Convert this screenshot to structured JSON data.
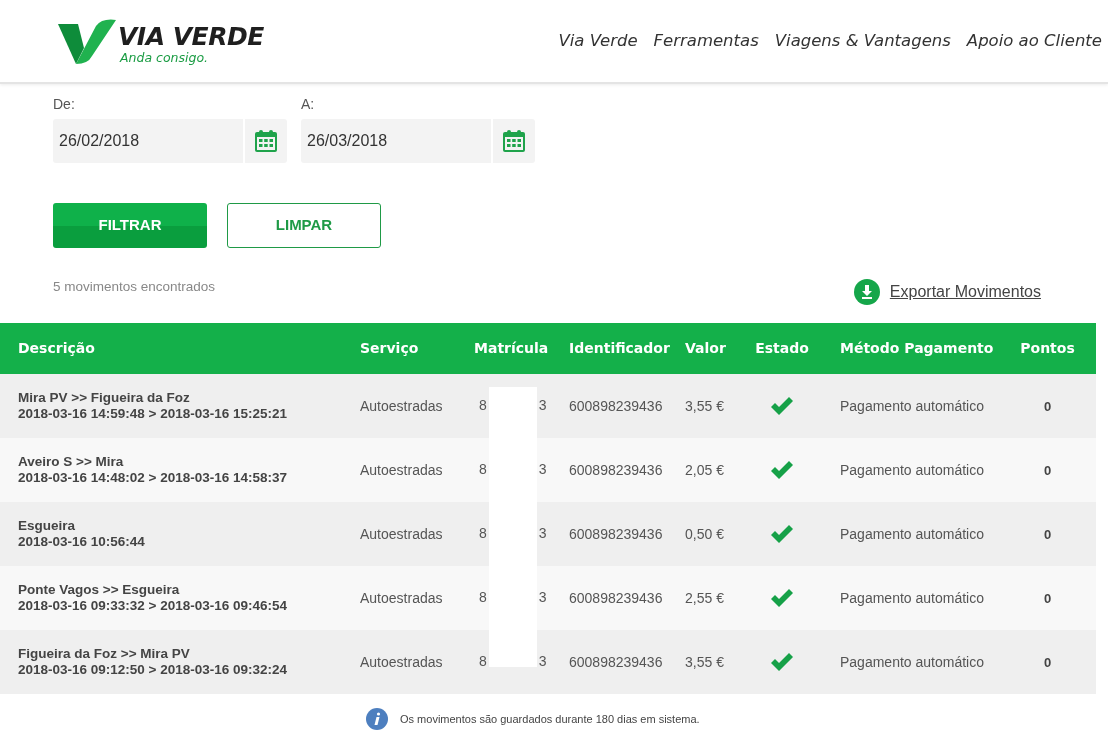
{
  "header": {
    "brand": "VIA VERDE",
    "tagline": "Anda consigo.",
    "nav": [
      "Via Verde",
      "Ferramentas",
      "Viagens & Vantagens",
      "Apoio ao Cliente"
    ]
  },
  "filters": [
    {
      "label": "De:",
      "value": "26/02/2018"
    },
    {
      "label": "A:",
      "value": "26/03/2018"
    }
  ],
  "buttons": {
    "primary": "FILTRAR",
    "secondary": "LIMPAR"
  },
  "result_count": "5 movimentos encontrados",
  "export_link": "Exportar Movimentos",
  "table": {
    "columns": [
      "Descrição",
      "Serviço",
      "Matrícula",
      "Identificador",
      "Valor",
      "Estado",
      "Método Pagamento",
      "Pontos"
    ],
    "rows": [
      {
        "route": "Mira PV >> Figueira da Foz",
        "time": "2018-03-16 14:59:48 > 2018-03-16 15:25:21",
        "service": "Autoestradas",
        "plate_start": "8",
        "plate_end": "3",
        "identifier": "600898239436",
        "value": "3,55 €",
        "paid": true,
        "payment": "Pagamento automático",
        "points": "0"
      },
      {
        "route": "Aveiro S >> Mira",
        "time": "2018-03-16 14:48:02 > 2018-03-16 14:58:37",
        "service": "Autoestradas",
        "plate_start": "8",
        "plate_end": "3",
        "identifier": "600898239436",
        "value": "2,05 €",
        "paid": true,
        "payment": "Pagamento automático",
        "points": "0"
      },
      {
        "route": "Esgueira",
        "time": "2018-03-16 10:56:44",
        "service": "Autoestradas",
        "plate_start": "8",
        "plate_end": "3",
        "identifier": "600898239436",
        "value": "0,50 €",
        "paid": true,
        "payment": "Pagamento automático",
        "points": "0"
      },
      {
        "route": "Ponte Vagos >> Esgueira",
        "time": "2018-03-16 09:33:32 > 2018-03-16 09:46:54",
        "service": "Autoestradas",
        "plate_start": "8",
        "plate_end": "3",
        "identifier": "600898239436",
        "value": "2,55 €",
        "paid": true,
        "payment": "Pagamento automático",
        "points": "0"
      },
      {
        "route": "Figueira da Foz >> Mira PV",
        "time": "2018-03-16 09:12:50 > 2018-03-16 09:32:24",
        "service": "Autoestradas",
        "plate_start": "8",
        "plate_end": "3",
        "identifier": "600898239436",
        "value": "3,55 €",
        "paid": true,
        "payment": "Pagamento automático",
        "points": "0"
      }
    ]
  },
  "info_note": "Os movimentos são guardados durante 180 dias em sistema."
}
